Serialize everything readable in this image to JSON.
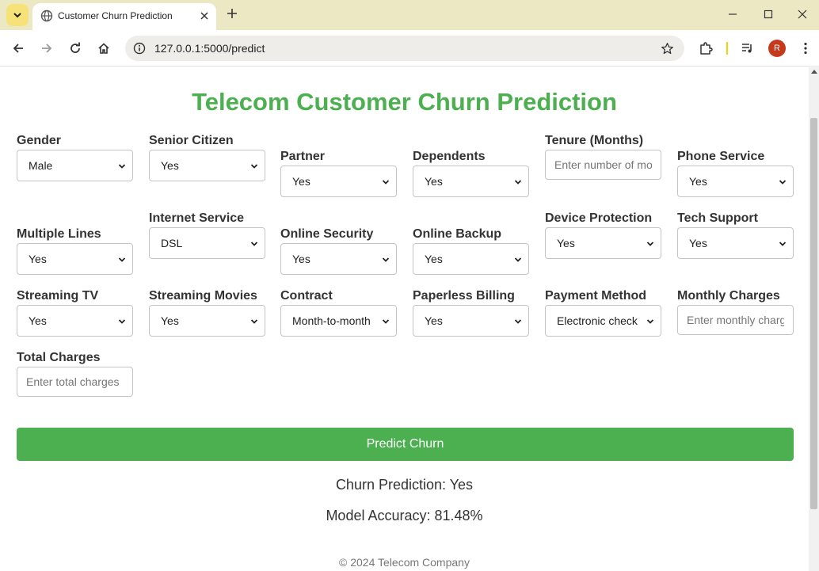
{
  "browser": {
    "tab_title": "Customer Churn Prediction",
    "url": "127.0.0.1:5000/predict",
    "profile_initial": "R",
    "accent_color": "#f7e27a"
  },
  "page": {
    "title": "Telecom Customer Churn Prediction",
    "fields": {
      "gender": {
        "label": "Gender",
        "value": "Male"
      },
      "senior_citizen": {
        "label": "Senior Citizen",
        "value": "Yes"
      },
      "partner": {
        "label": "Partner",
        "value": "Yes"
      },
      "dependents": {
        "label": "Dependents",
        "value": "Yes"
      },
      "tenure": {
        "label": "Tenure (Months)",
        "placeholder": "Enter number of months"
      },
      "phone_service": {
        "label": "Phone Service",
        "value": "Yes"
      },
      "multiple_lines": {
        "label": "Multiple Lines",
        "value": "Yes"
      },
      "internet_service": {
        "label": "Internet Service",
        "value": "DSL"
      },
      "online_security": {
        "label": "Online Security",
        "value": "Yes"
      },
      "online_backup": {
        "label": "Online Backup",
        "value": "Yes"
      },
      "device_protection": {
        "label": "Device Protection",
        "value": "Yes"
      },
      "tech_support": {
        "label": "Tech Support",
        "value": "Yes"
      },
      "streaming_tv": {
        "label": "Streaming TV",
        "value": "Yes"
      },
      "streaming_movies": {
        "label": "Streaming Movies",
        "value": "Yes"
      },
      "contract": {
        "label": "Contract",
        "value": "Month-to-month"
      },
      "paperless_billing": {
        "label": "Paperless Billing",
        "value": "Yes"
      },
      "payment_method": {
        "label": "Payment Method",
        "value": "Electronic check"
      },
      "monthly_charges": {
        "label": "Monthly Charges",
        "placeholder": "Enter monthly charges"
      },
      "total_charges": {
        "label": "Total Charges",
        "placeholder": "Enter total charges"
      }
    },
    "predict_button": "Predict Churn",
    "result": "Churn Prediction: Yes",
    "accuracy": "Model Accuracy: 81.48%",
    "footer": "© 2024 Telecom Company",
    "brand_color": "#4caf50"
  }
}
